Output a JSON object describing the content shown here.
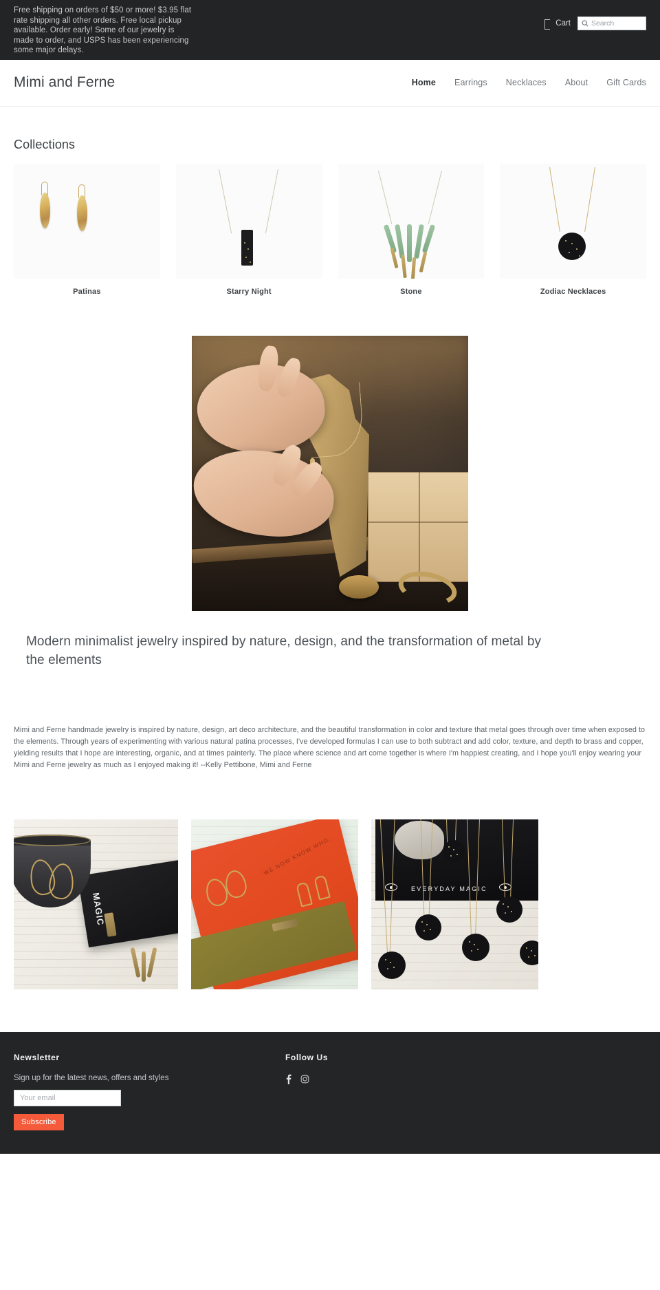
{
  "announcement": {
    "text": "Free shipping on orders of $50 or more! $3.95 flat rate shipping all other orders. Free local pickup available. Order early! Some of our jewelry is made to order, and USPS has been experiencing some major delays.",
    "cart_label": "Cart",
    "cart_icon": "shopping-bag-icon",
    "search_icon": "search-icon",
    "search_placeholder": "Search",
    "search_value": "",
    "background_color": "#222426"
  },
  "header": {
    "brand": "Mimi and Ferne",
    "nav": [
      {
        "label": "Home",
        "active": true
      },
      {
        "label": "Earrings",
        "active": false
      },
      {
        "label": "Necklaces",
        "active": false
      },
      {
        "label": "About",
        "active": false
      },
      {
        "label": "Gift Cards",
        "active": false
      }
    ]
  },
  "collections": {
    "title": "Collections",
    "items": [
      {
        "label": "Patinas",
        "art": "gold-patina-earrings"
      },
      {
        "label": "Starry Night",
        "art": "black-bar-necklace"
      },
      {
        "label": "Stone",
        "art": "green-stone-fringe-necklace"
      },
      {
        "label": "Zodiac Necklaces",
        "art": "black-constellation-disc-necklace"
      }
    ]
  },
  "hero": {
    "alt": "Hands holding a wooden jewelry display board with a gold necklace in a shop"
  },
  "tagline": "Modern minimalist jewelry inspired by nature, design, and the transformation of metal by the elements",
  "body_copy": "Mimi and Ferne handmade jewelry is inspired by nature, design, art deco architecture, and the beautiful transformation in color and texture that metal goes through over time when exposed to the elements.  Through years of experimenting with various natural patina processes, I've developed formulas I can use to both subtract and add color, texture, and depth to brass and copper, yielding results that I hope are interesting, organic, and at times painterly.  The place where science and art come together is where I'm happiest creating, and I hope you'll enjoy wearing your Mimi and Ferne jewelry as much as I enjoyed making it!  --Kelly Pettibone, Mimi and Ferne",
  "gallery": {
    "items": [
      {
        "alt": "Brass teardrop earrings, patina bar necklace and fringe necklace with a dark bowl and Everyday Magic book",
        "book_text": "MAGIC"
      },
      {
        "alt": "Gold hoop and rectangle earrings with a patina bar necklace on an orange notebook",
        "emboss": "WE NOW\nKNOW WHO."
      },
      {
        "alt": "Black constellation zodiac disc necklaces on gold chains over an Everyday Magic book",
        "book_text": "EVERYDAY MAGIC"
      }
    ]
  },
  "footer": {
    "newsletter": {
      "heading": "Newsletter",
      "description": "Sign up for the latest news, offers and styles",
      "email_placeholder": "Your email",
      "email_value": "",
      "subscribe_label": "Subscribe",
      "button_color": "#f55b3b"
    },
    "follow": {
      "heading": "Follow Us",
      "socials": [
        {
          "name": "facebook-icon",
          "glyph": "f"
        },
        {
          "name": "instagram-icon",
          "glyph": ""
        }
      ]
    },
    "background_color": "#232527"
  }
}
